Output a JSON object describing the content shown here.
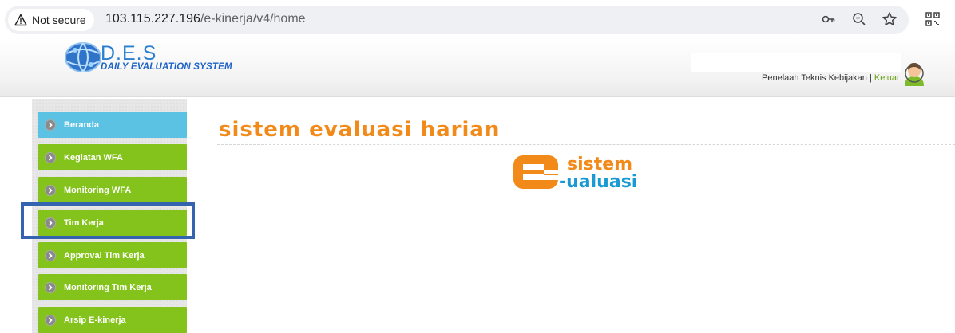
{
  "browser": {
    "security_label": "Not secure",
    "url_host": "103.115.227.196",
    "url_path": "/e-kinerja/v4/home"
  },
  "header": {
    "logo_text": "D.E.S",
    "logo_subtitle": "DAILY EVALUATION SYSTEM",
    "user_role": "Penelaah Teknis Kebijakan",
    "separator": " | ",
    "logout_label": "Keluar"
  },
  "sidebar": {
    "items": [
      {
        "label": "Beranda",
        "active": true
      },
      {
        "label": "Kegiatan WFA",
        "active": false
      },
      {
        "label": "Monitoring WFA",
        "active": false
      },
      {
        "label": "Tim Kerja",
        "active": false
      },
      {
        "label": "Approval Tim Kerja",
        "active": false
      },
      {
        "label": "Monitoring Tim Kerja",
        "active": false
      },
      {
        "label": "Arsip E-kinerja",
        "active": false
      }
    ]
  },
  "main": {
    "title": "sistem evaluasi harian",
    "brand_line1": "sistem",
    "brand_line2": "-ualuasi"
  },
  "colors": {
    "menu_green": "#84c31b",
    "menu_active": "#5cc2e4",
    "title_orange": "#f28a1a",
    "highlight": "#3463b0"
  }
}
